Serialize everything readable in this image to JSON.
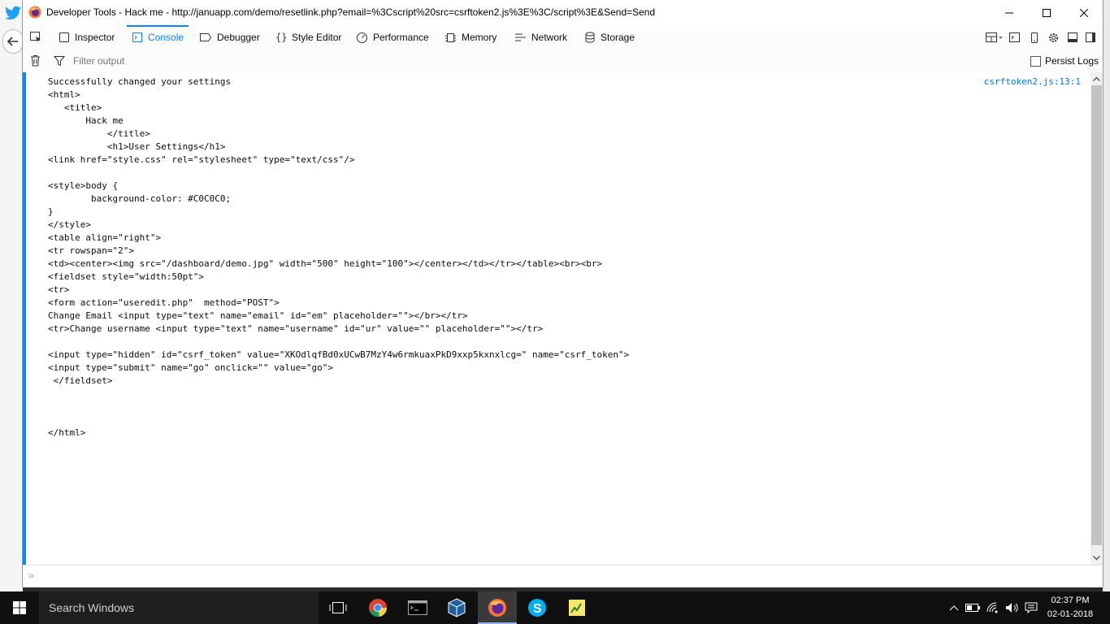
{
  "window": {
    "title": "Developer Tools - Hack me - http://januapp.com/demo/resetlink.php?email=%3Cscript%20src=csrftoken2.js%3E%3C/script%3E&Send=Send"
  },
  "tabs": [
    {
      "label": "Inspector",
      "icon": "inspector-icon"
    },
    {
      "label": "Console",
      "icon": "console-icon",
      "active": true
    },
    {
      "label": "Debugger",
      "icon": "debugger-icon"
    },
    {
      "label": "Style Editor",
      "icon": "style-editor-icon"
    },
    {
      "label": "Performance",
      "icon": "performance-icon"
    },
    {
      "label": "Memory",
      "icon": "memory-icon"
    },
    {
      "label": "Network",
      "icon": "network-icon"
    },
    {
      "label": "Storage",
      "icon": "storage-icon"
    }
  ],
  "filter": {
    "placeholder": "Filter output",
    "persist_logs_label": "Persist Logs",
    "persist_logs_checked": false
  },
  "console": {
    "source_link": "csrftoken2.js:13:1",
    "lines": [
      "Successfully changed your settings",
      "<html>",
      "   <title>",
      "       Hack me",
      "           </title>",
      "           <h1>User Settings</h1>",
      "<link href=\"style.css\" rel=\"stylesheet\" type=\"text/css\"/>",
      "",
      "<style>body {",
      "        background-color: #C0C0C0;",
      "}",
      "</style>",
      "<table align=\"right\">",
      "<tr rowspan=\"2\">",
      "<td><center><img src=\"/dashboard/demo.jpg\" width=\"500\" height=\"100\"></center></td></tr></table><br><br>",
      "<fieldset style=\"width:50pt\">",
      "<tr>",
      "<form action=\"useredit.php\"  method=\"POST\">",
      "Change Email <input type=\"text\" name=\"email\" id=\"em\" placeholder=\"\"></br></tr>",
      "<tr>Change username <input type=\"text\" name=\"username\" id=\"ur\" value=\"\" placeholder=\"\"></tr>",
      "",
      "<input type=\"hidden\" id=\"csrf_token\" value=\"XKOdlqfBd0xUCwB7MzY4w6rmkuaxPkD9xxp5kxnxlcg=\" name=\"csrf_token\">",
      "<input type=\"submit\" name=\"go\" onclick=\"\" value=\"go\">",
      " </fieldset>",
      "",
      "",
      "",
      "</html>"
    ]
  },
  "taskbar": {
    "search_placeholder": "Search Windows",
    "time": "02:37 PM",
    "date": "02-01-2018"
  },
  "colors": {
    "accent": "#0a84ff",
    "link": "#0074e8"
  }
}
